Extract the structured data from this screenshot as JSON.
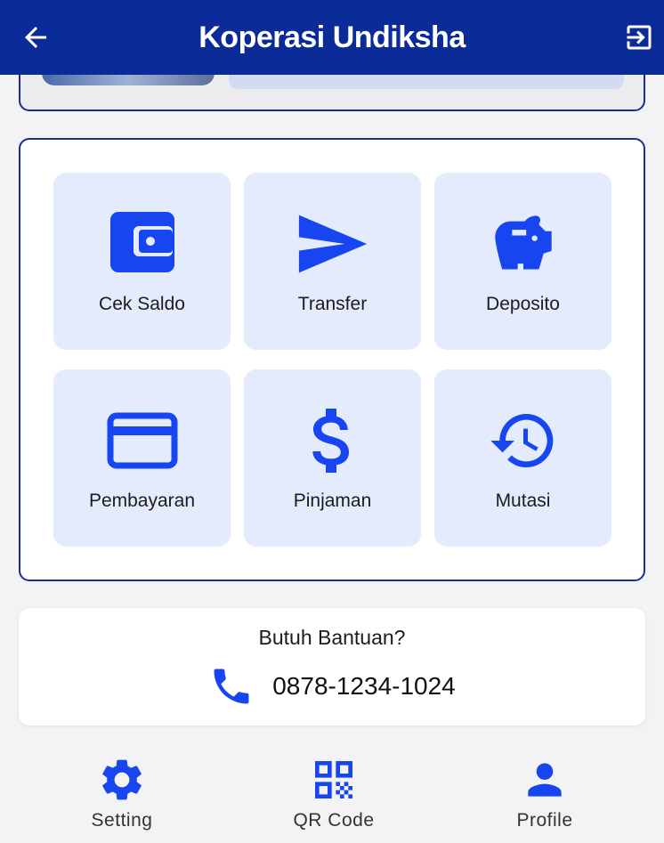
{
  "appbar": {
    "title": "Koperasi Undiksha"
  },
  "menu": {
    "items": [
      {
        "label": "Cek Saldo"
      },
      {
        "label": "Transfer"
      },
      {
        "label": "Deposito"
      },
      {
        "label": "Pembayaran"
      },
      {
        "label": "Pinjaman"
      },
      {
        "label": "Mutasi"
      }
    ]
  },
  "help": {
    "question": "Butuh Bantuan?",
    "phone": "0878-1234-1024"
  },
  "bottom_nav": {
    "items": [
      {
        "label": "Setting"
      },
      {
        "label": "QR Code"
      },
      {
        "label": "Profile"
      }
    ]
  },
  "colors": {
    "primary": "#0b2b99",
    "accent": "#1745f0",
    "tile_bg": "#e4ebfd",
    "border": "#1a2e8f"
  }
}
